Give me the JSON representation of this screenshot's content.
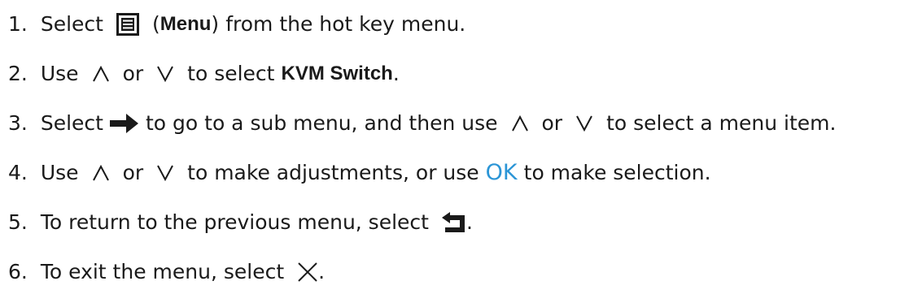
{
  "steps": [
    {
      "number": "1.",
      "parts": {
        "a": "Select",
        "b_open": "(",
        "b_bold": "Menu",
        "b_close": ")",
        "c": "from the hot key menu."
      }
    },
    {
      "number": "2.",
      "parts": {
        "a": "Use",
        "b": "or",
        "c": "to select",
        "d_bold": "KVM Switch",
        "e": "."
      }
    },
    {
      "number": "3.",
      "parts": {
        "a": "Select",
        "b": "to go to a sub menu, and then use",
        "c": "or",
        "d": "to select a menu item."
      }
    },
    {
      "number": "4.",
      "parts": {
        "a": "Use",
        "b": "or",
        "c": "to make adjustments, or use",
        "ok": "OK",
        "d": "to make selection."
      }
    },
    {
      "number": "5.",
      "parts": {
        "a": "To return to the previous menu, select",
        "b": "."
      }
    },
    {
      "number": "6.",
      "parts": {
        "a": "To exit the menu, select",
        "b": "."
      }
    }
  ],
  "icons": {
    "menu": "menu-icon",
    "up": "up-chevron-icon",
    "down": "down-chevron-icon",
    "right_arrow": "right-arrow-icon",
    "back": "back-arrow-icon",
    "close": "close-icon"
  },
  "colors": {
    "text": "#1a1a1a",
    "ok_accent": "#2b95d6"
  }
}
